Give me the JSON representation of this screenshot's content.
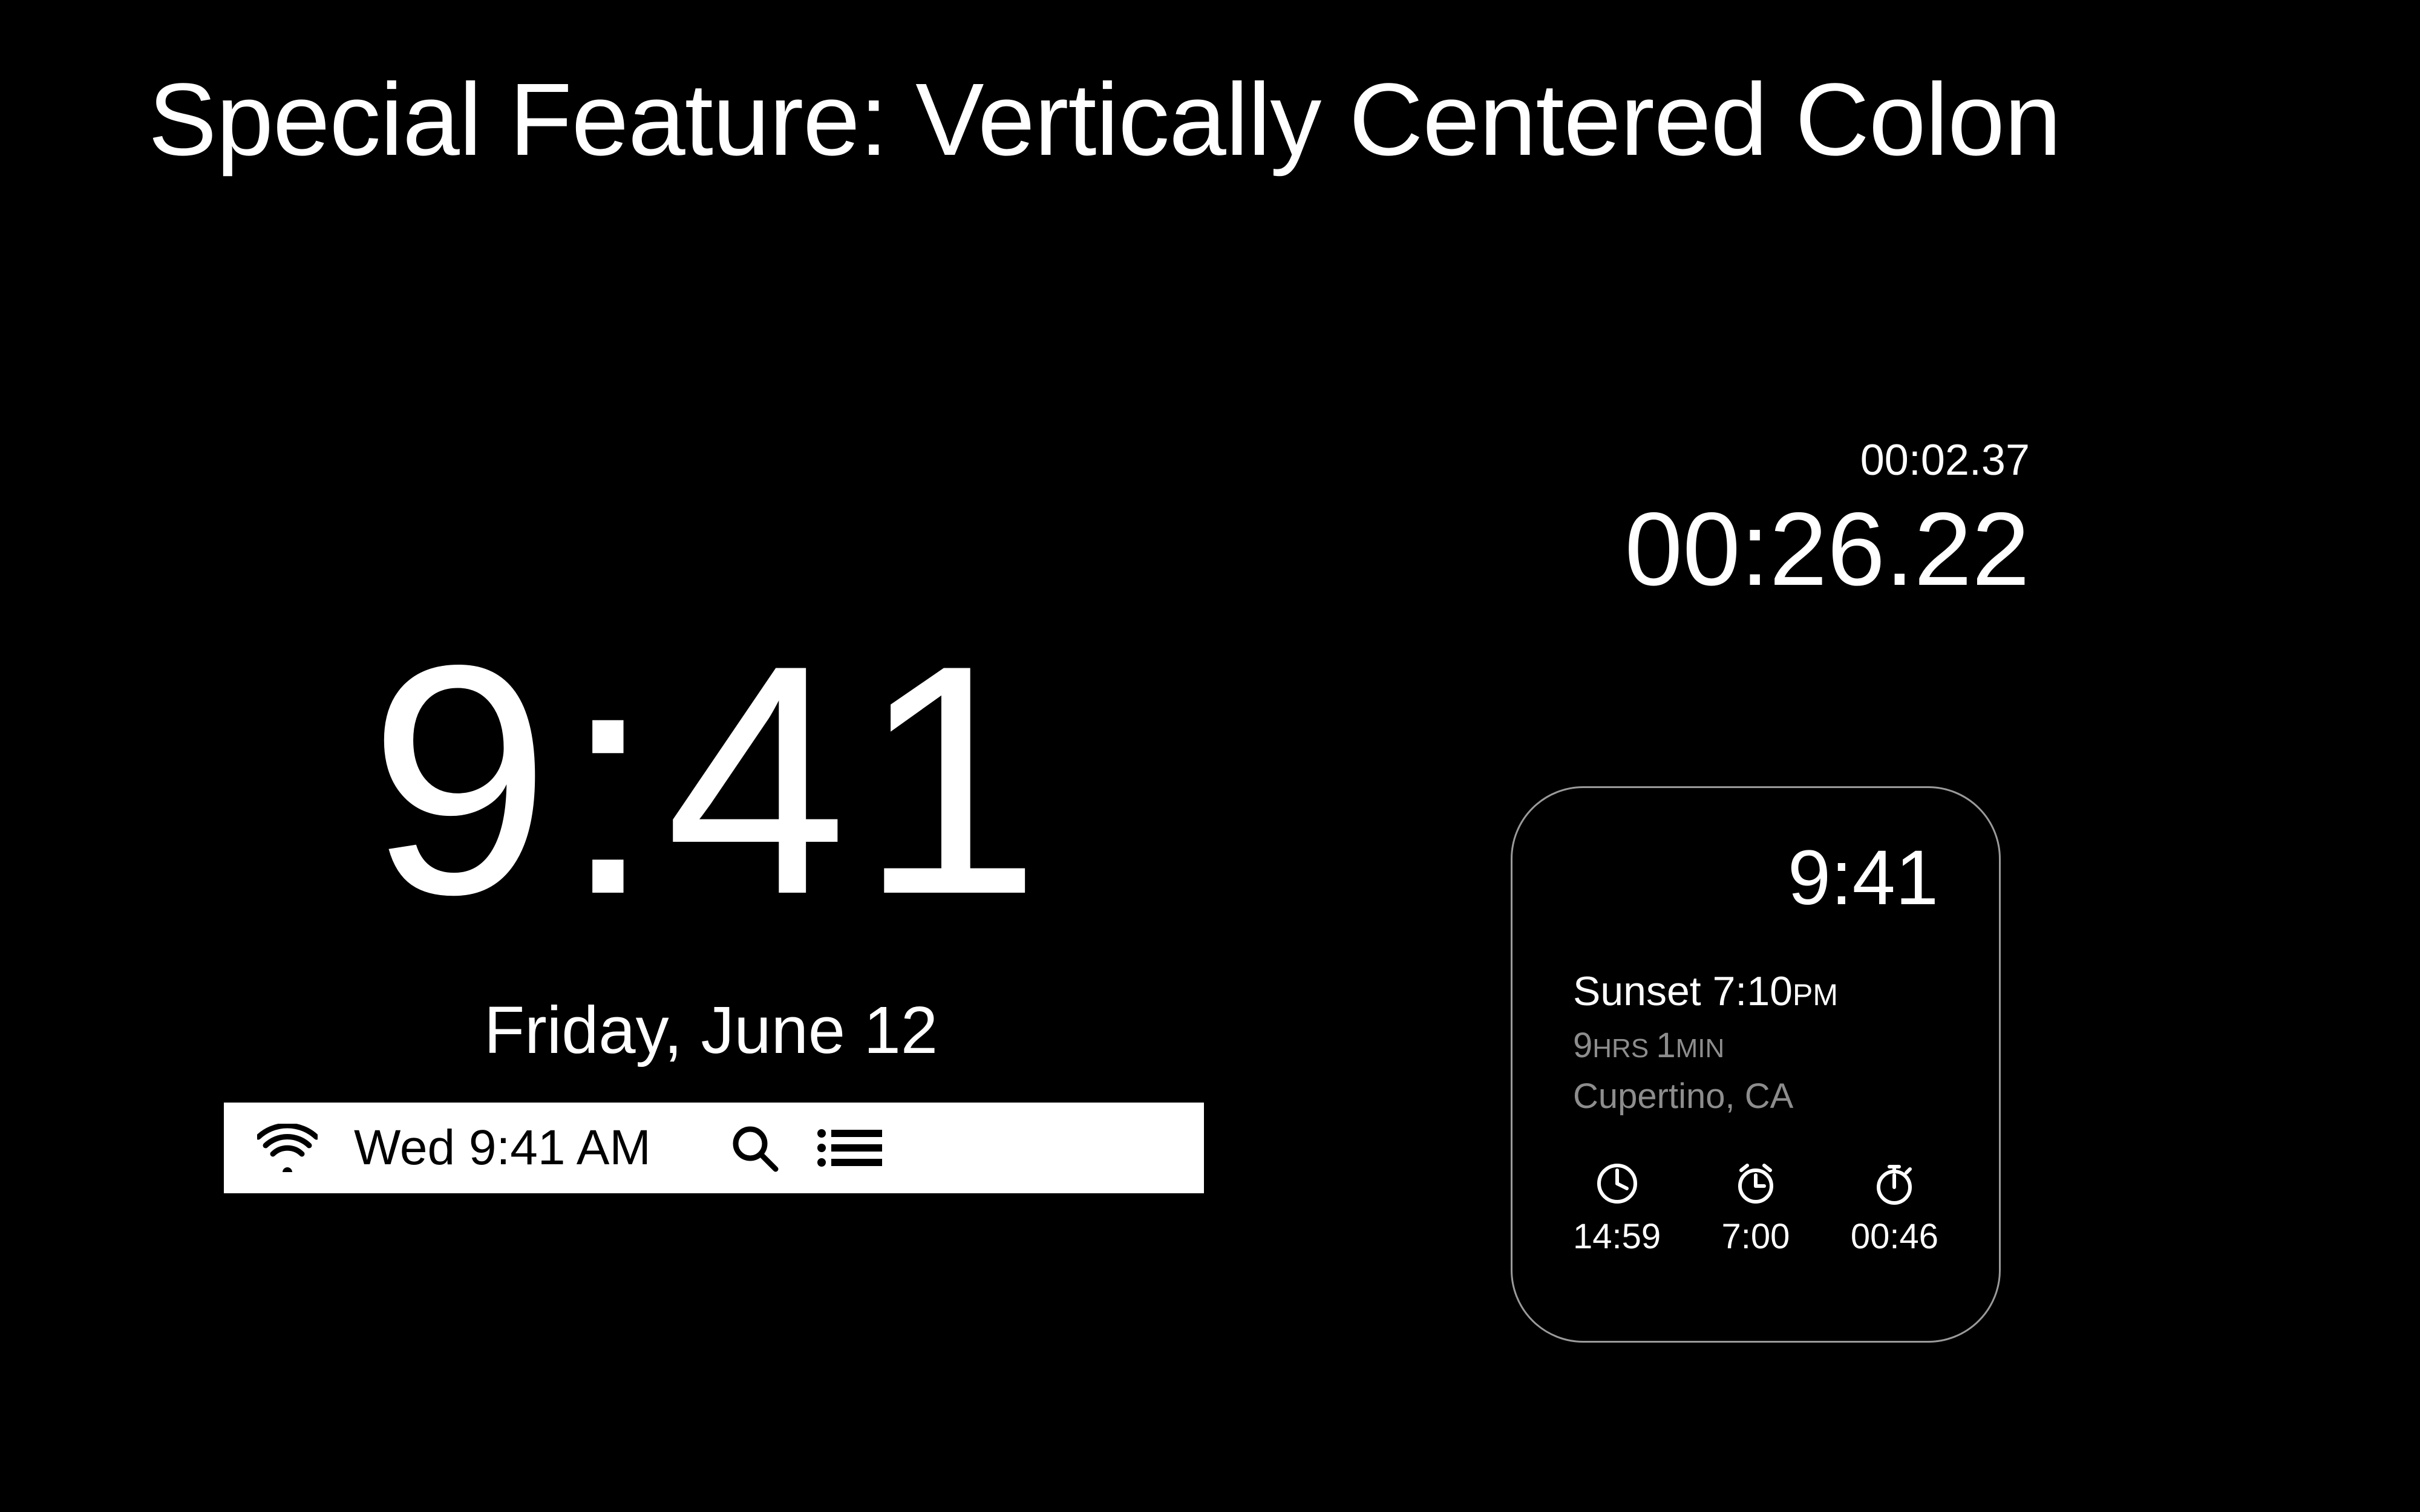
{
  "title": "Special Feature: Vertically Centered Colon",
  "lock_screen": {
    "time": "9:41",
    "date": "Friday, June 12"
  },
  "stopwatch": {
    "lap": "00:02.37",
    "elapsed": "00:26.22"
  },
  "menubar": {
    "time": "Wed 9:41 AM"
  },
  "watch": {
    "time": "9:41",
    "sunset_label": "Sunset ",
    "sunset_time": "7:10",
    "sunset_ampm": "PM",
    "remaining_hours": "9",
    "remaining_hours_unit": "HRS ",
    "remaining_mins": "1",
    "remaining_mins_unit": "MIN",
    "location": "Cupertino, CA",
    "complications": {
      "timer": "14:59",
      "alarm": "7:00",
      "stopwatch": "00:46"
    }
  }
}
